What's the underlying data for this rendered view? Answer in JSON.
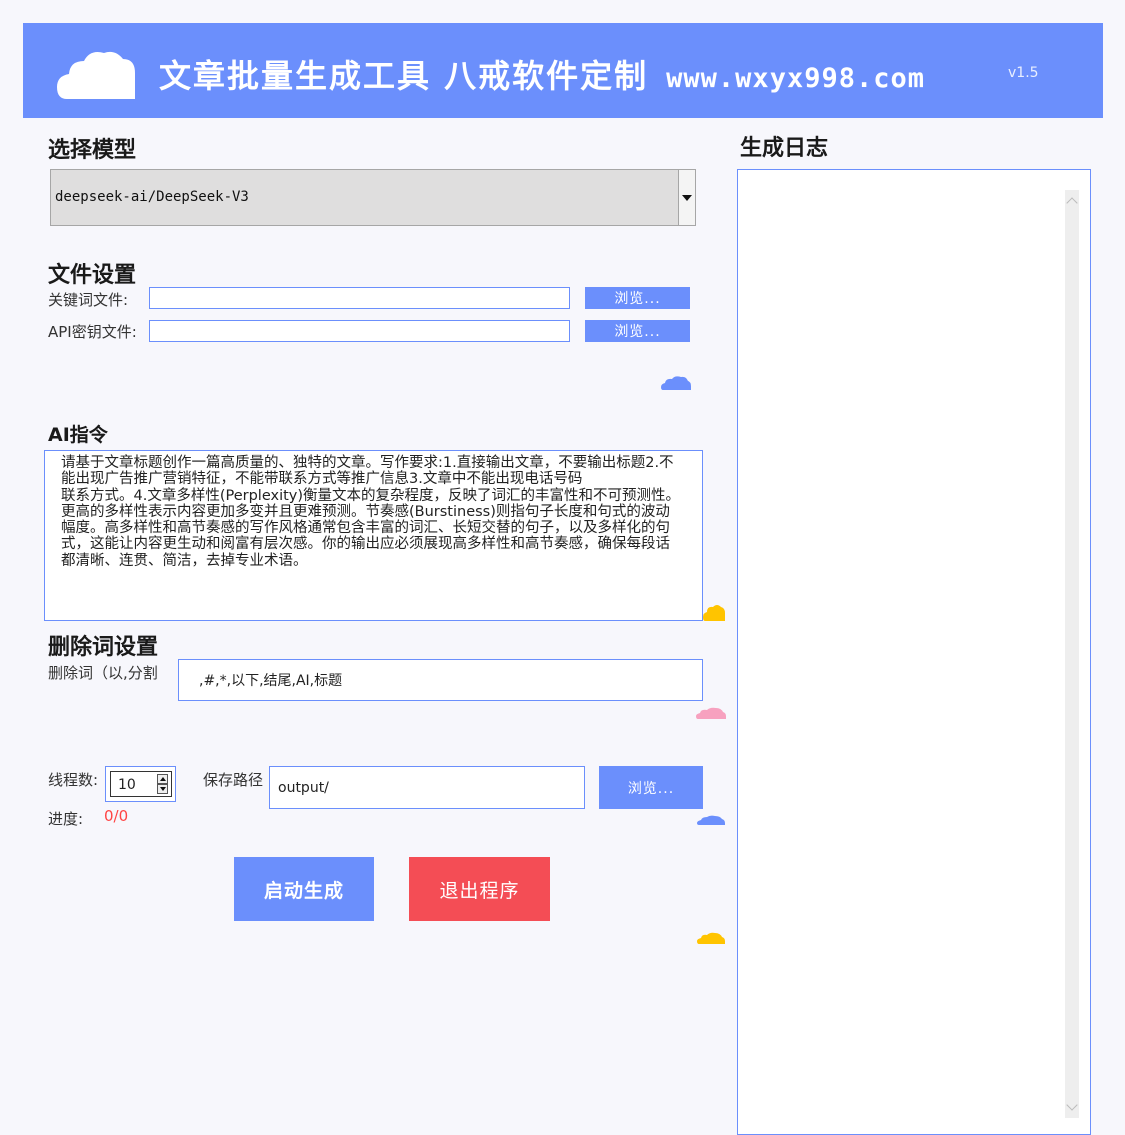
{
  "header": {
    "title": "文章批量生成工具 八戒软件定制",
    "url": "www.wxyx998.com",
    "version": "v1.5"
  },
  "model": {
    "section_title": "选择模型",
    "selected": "deepseek-ai/DeepSeek-V3"
  },
  "files": {
    "section_title": "文件设置",
    "keyword_label": "关键词文件:",
    "apikey_label": "API密钥文件:",
    "keyword_value": "",
    "apikey_value": "",
    "browse_label": "浏览..."
  },
  "ai": {
    "section_title": "AI指令",
    "prompt": "请基于文章标题创作一篇高质量的、独特的文章。写作要求:1.直接输出文章，不要输出标题2.不能出现广告推广营销特征，不能带联系方式等推广信息3.文章中不能出现电话号码\n联系方式。4.文章多样性(Perplexity)衡量文本的复杂程度，反映了词汇的丰富性和不可预测性。更高的多样性表示内容更加多变并且更难预测。节奏感(Burstiness)则指句子长度和句式的波动幅度。高多样性和高节奏感的写作风格通常包含丰富的词汇、长短交替的句子，以及多样化的句式，这能让内容更生动和阅富有层次感。你的输出应必须展现高多样性和高节奏感，确保每段话都清晰、连贯、简洁，去掉专业术语。"
  },
  "delete_words": {
    "section_title": "删除词设置",
    "label": "删除词（以,分割",
    "value": ",#,*,以下,结尾,AI,标题"
  },
  "run": {
    "threads_label": "线程数:",
    "threads_value": "10",
    "save_label": "保存路径",
    "save_value": "output/",
    "browse_label": "浏览...",
    "progress_label": "进度:",
    "progress_value": "0/0",
    "start_label": "启动生成",
    "exit_label": "退出程序"
  },
  "log": {
    "section_title": "生成日志"
  },
  "colors": {
    "accent": "#6b8ffc",
    "danger": "#f44d55",
    "cloud_yellow": "#ffc400",
    "cloud_pink": "#f7a1bf"
  },
  "icons": [
    "cloud-logo-icon",
    "cloud-deco-icon",
    "chevron-down-icon",
    "chevron-up-icon"
  ]
}
